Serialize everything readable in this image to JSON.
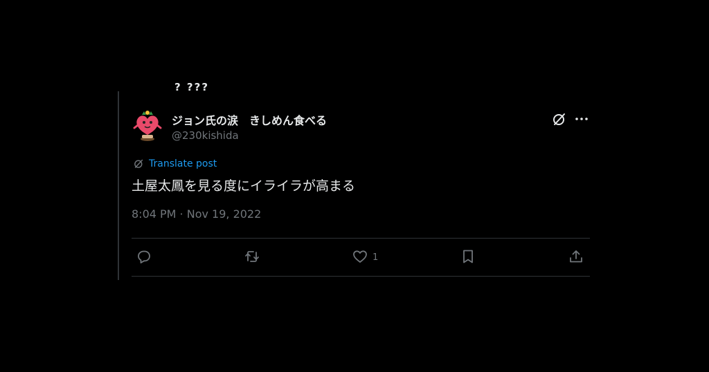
{
  "previous_tweet": {
    "cutoff_text": "? ???"
  },
  "tweet": {
    "author_name": "ジョン氏の涙　きしめん食べる",
    "handle": "@230kishida",
    "translate_label": "Translate post",
    "text": "土屋太鳳を見る度にイライラが高まる",
    "timestamp": "8:04 PM · Nov 19, 2022"
  },
  "actions": {
    "reply_count": "",
    "repost_count": "",
    "like_count": "1"
  },
  "icons": {
    "avatar": "mascot-avatar",
    "grok": "grok-icon",
    "more": "more-icon",
    "translate": "translate-icon",
    "reply": "reply-icon",
    "repost": "repost-icon",
    "like": "heart-icon",
    "bookmark": "bookmark-icon",
    "share": "share-icon"
  },
  "colors": {
    "background": "#000000",
    "text": "#e7e9ea",
    "secondary": "#71767b",
    "link": "#1d9bf0",
    "border": "#2f3336"
  }
}
